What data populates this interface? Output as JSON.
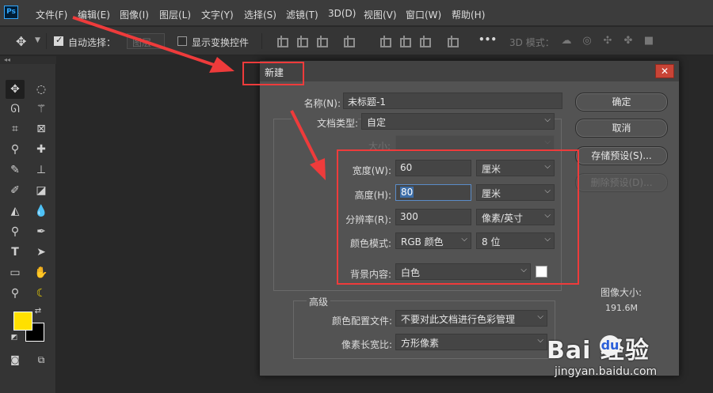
{
  "app": {
    "logo_text": "Ps"
  },
  "menubar": {
    "items": [
      "文件(F)",
      "编辑(E)",
      "图像(I)",
      "图层(L)",
      "文字(Y)",
      "选择(S)",
      "滤镜(T)",
      "3D(D)",
      "视图(V)",
      "窗口(W)",
      "帮助(H)"
    ]
  },
  "options_bar": {
    "auto_select_label": "自动选择：",
    "auto_select_checked": true,
    "auto_select_value": "图层",
    "show_transform_label": "显示变换控件",
    "show_transform_checked": false,
    "more_label": "•••",
    "mode_3d_label": "3D 模式："
  },
  "tool_panel": {
    "collapse_label": "◂◂",
    "foreground_color": "#ffe000",
    "background_color": "#000000"
  },
  "dialog": {
    "title": "新建",
    "close_label": "✕",
    "name_label": "名称(N):",
    "name_value": "未标题-1",
    "doc_type_label": "文档类型:",
    "doc_type_value": "自定",
    "size_label": "大小:",
    "width_label": "宽度(W):",
    "width_value": "60",
    "width_unit": "厘米",
    "height_label": "高度(H):",
    "height_value": "80",
    "height_unit": "厘米",
    "resolution_label": "分辨率(R):",
    "resolution_value": "300",
    "resolution_unit": "像素/英寸",
    "color_mode_label": "颜色模式:",
    "color_mode_value": "RGB 颜色",
    "bit_depth_value": "8 位",
    "bg_content_label": "背景内容:",
    "bg_content_value": "白色",
    "bg_swatch_color": "#ffffff",
    "advanced_label": "高级",
    "color_profile_label": "颜色配置文件:",
    "color_profile_value": "不要对此文档进行色彩管理",
    "pixel_aspect_label": "像素长宽比:",
    "pixel_aspect_value": "方形像素",
    "buttons": {
      "ok": "确定",
      "cancel": "取消",
      "save_preset": "存储预设(S)...",
      "delete_preset": "删除预设(D)..."
    },
    "image_size_label": "图像大小:",
    "image_size_value": "191.6M"
  },
  "annotations": {
    "color": "#ee3b3b"
  },
  "watermark": {
    "logo_text": "Bai  经验",
    "url_text": "jingyan.baidu.com"
  }
}
